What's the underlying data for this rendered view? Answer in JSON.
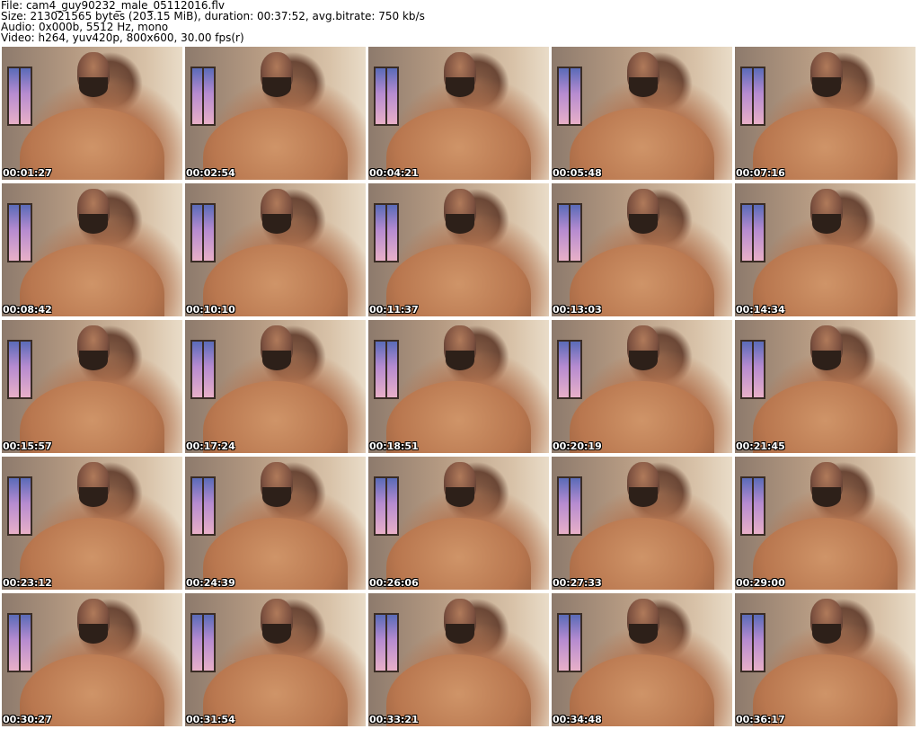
{
  "header": {
    "file_line": "File: cam4_guy90232_male_05112016.flv",
    "size_line": "Size: 213021565 bytes (203.15 MiB), duration: 00:37:52, avg.bitrate: 750 kb/s",
    "audio_line": "Audio: 0x000b, 5512 Hz, mono",
    "video_line": "Video: h264, yuv420p, 800x600, 30.00 fps(r)"
  },
  "thumbnails": [
    {
      "time": "00:01:27"
    },
    {
      "time": "00:02:54"
    },
    {
      "time": "00:04:21"
    },
    {
      "time": "00:05:48"
    },
    {
      "time": "00:07:16"
    },
    {
      "time": "00:08:42"
    },
    {
      "time": "00:10:10"
    },
    {
      "time": "00:11:37"
    },
    {
      "time": "00:13:03"
    },
    {
      "time": "00:14:34"
    },
    {
      "time": "00:15:57"
    },
    {
      "time": "00:17:24"
    },
    {
      "time": "00:18:51"
    },
    {
      "time": "00:20:19"
    },
    {
      "time": "00:21:45"
    },
    {
      "time": "00:23:12"
    },
    {
      "time": "00:24:39"
    },
    {
      "time": "00:26:06"
    },
    {
      "time": "00:27:33"
    },
    {
      "time": "00:29:00"
    },
    {
      "time": "00:30:27"
    },
    {
      "time": "00:31:54"
    },
    {
      "time": "00:33:21"
    },
    {
      "time": "00:34:48"
    },
    {
      "time": "00:36:17"
    }
  ]
}
